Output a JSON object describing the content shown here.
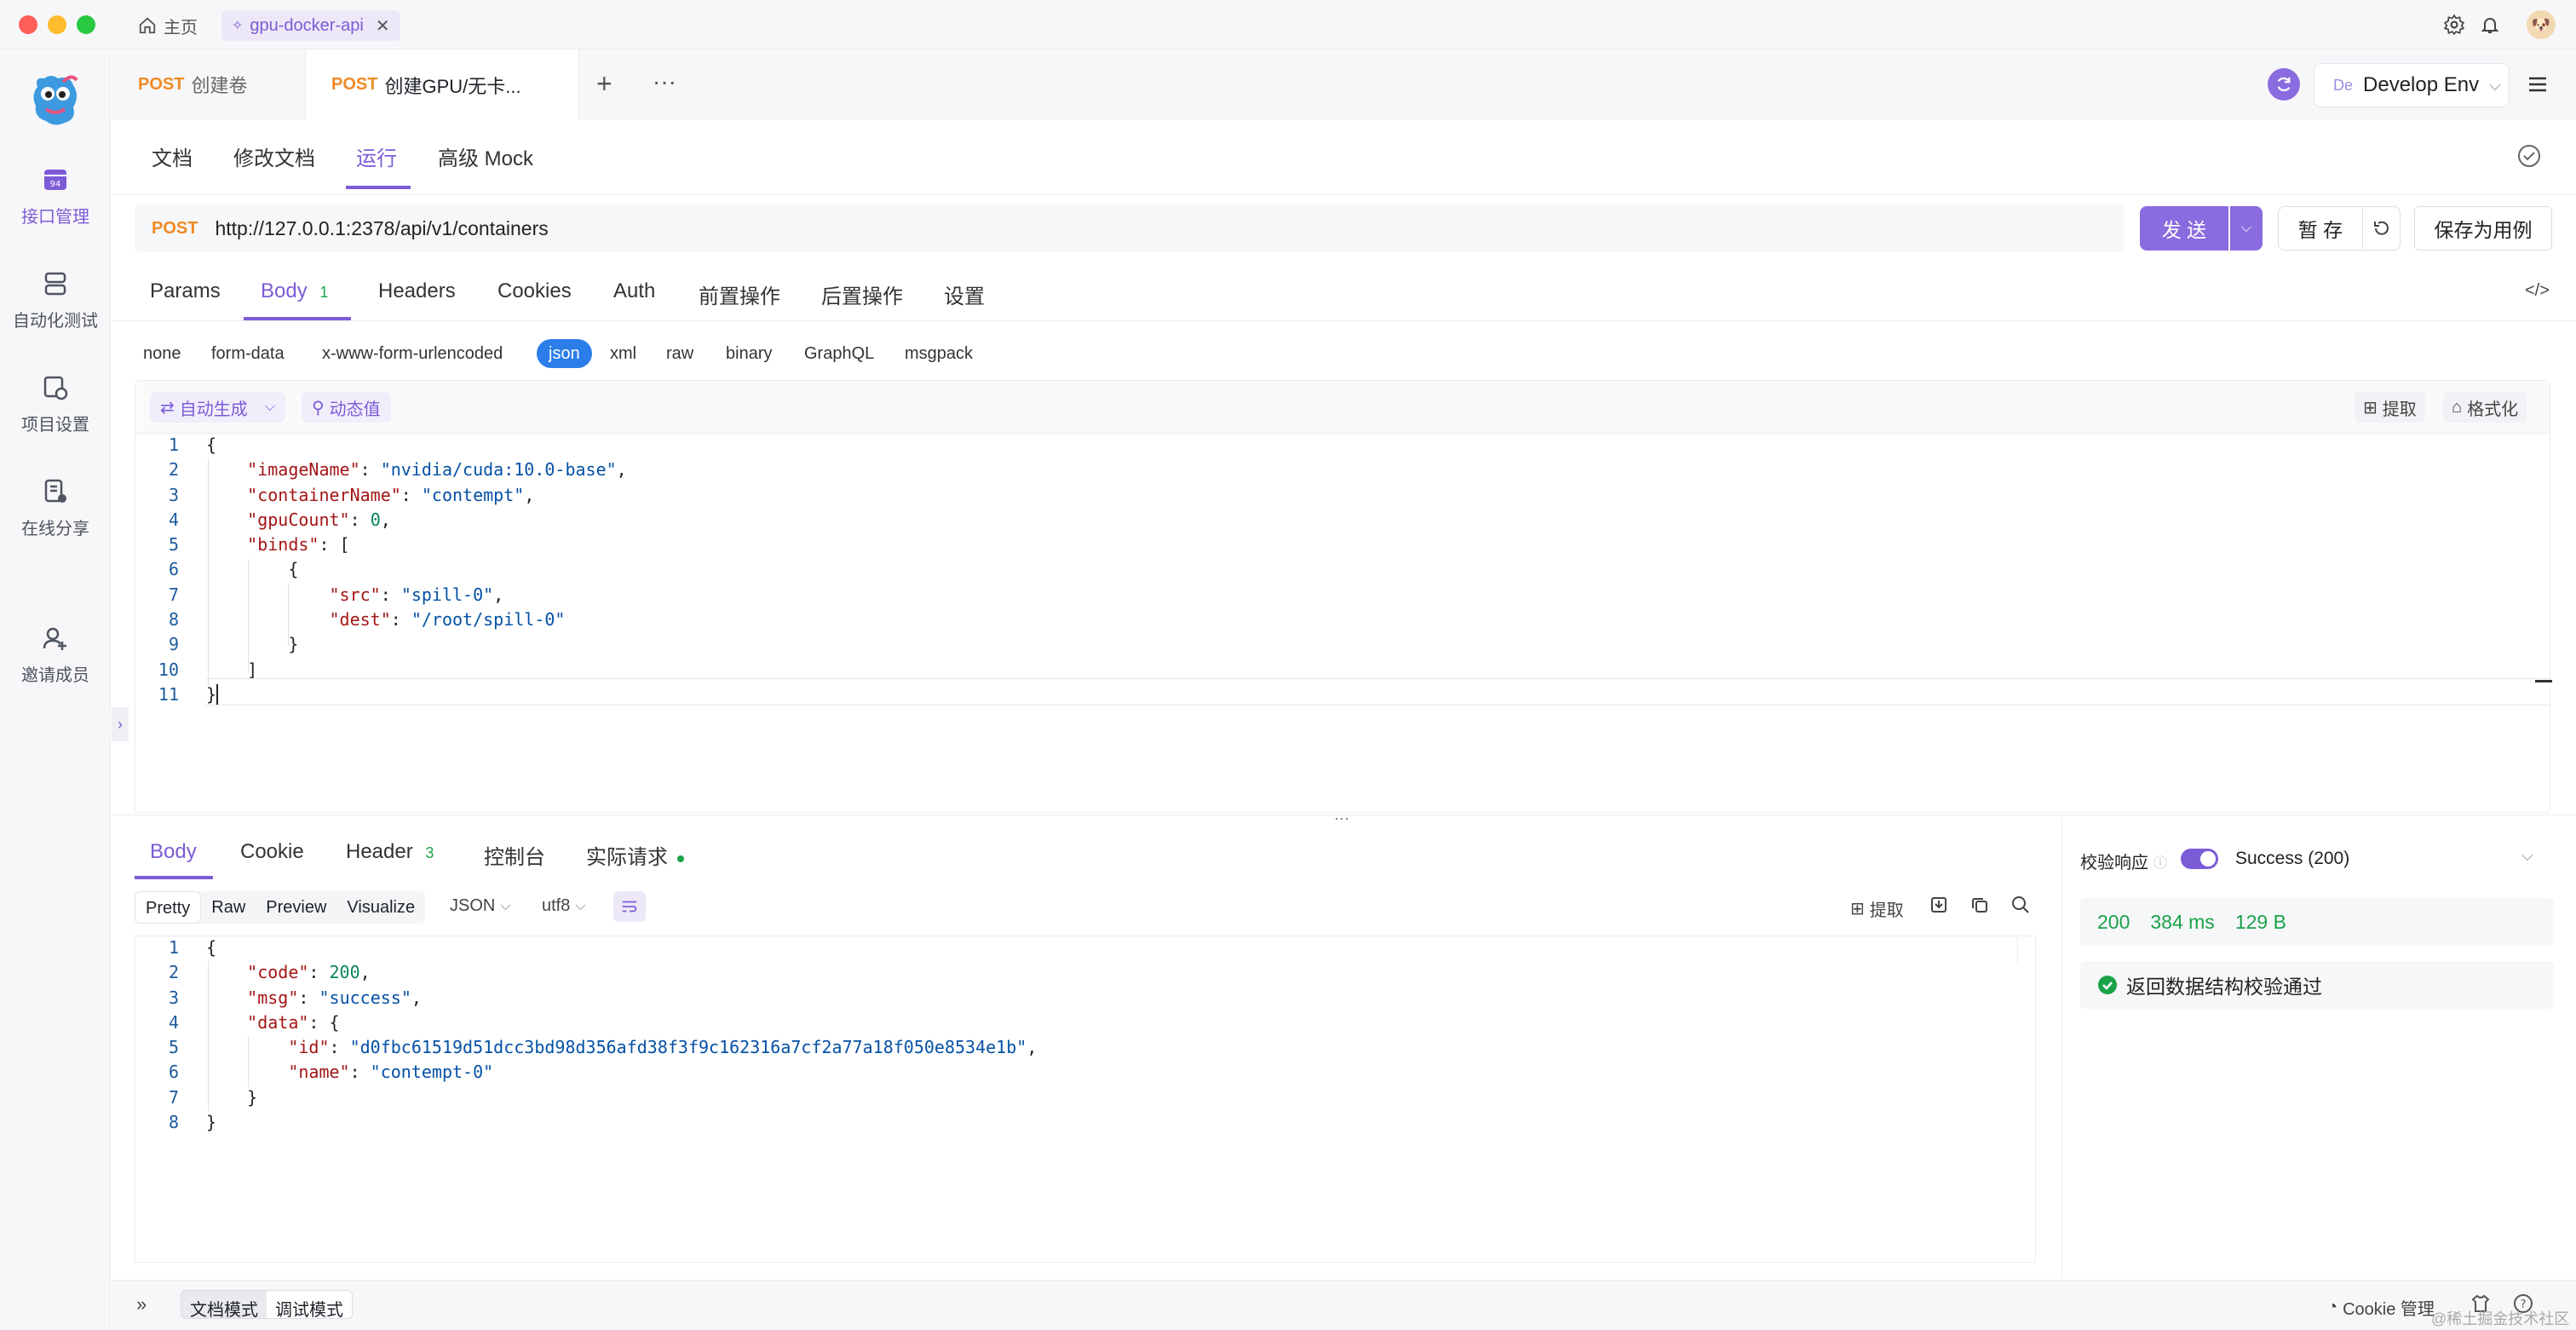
{
  "titlebar": {
    "home_tab": "主页",
    "project_tab": "gpu-docker-api"
  },
  "sidebar": {
    "items": [
      {
        "label": "接口管理"
      },
      {
        "label": "自动化测试"
      },
      {
        "label": "项目设置"
      },
      {
        "label": "在线分享"
      },
      {
        "label": "邀请成员"
      }
    ]
  },
  "request_tabs": [
    {
      "method": "POST",
      "label": "创建卷"
    },
    {
      "method": "POST",
      "label": "创建GPU/无卡..."
    }
  ],
  "env": {
    "badge": "De",
    "name": "Develop Env"
  },
  "nav_tabs": [
    "文档",
    "修改文档",
    "运行",
    "高级 Mock"
  ],
  "request": {
    "method": "POST",
    "url": "http://127.0.0.1:2378/api/v1/containers",
    "send_label": "发 送",
    "save_label": "暂 存",
    "save_case_label": "保存为用例"
  },
  "param_tabs": {
    "params": "Params",
    "body": "Body",
    "body_count": "1",
    "headers": "Headers",
    "cookies": "Cookies",
    "auth": "Auth",
    "pre": "前置操作",
    "post": "后置操作",
    "settings": "设置"
  },
  "body_formats": [
    "none",
    "form-data",
    "x-www-form-urlencoded",
    "json",
    "xml",
    "raw",
    "binary",
    "GraphQL",
    "msgpack"
  ],
  "editor_tools": {
    "auto_gen": "自动生成",
    "dynamic": "动态值",
    "extract": "提取",
    "format": "格式化"
  },
  "request_body": {
    "line_numbers": [
      "1",
      "2",
      "3",
      "4",
      "5",
      "6",
      "7",
      "8",
      "9",
      "10",
      "11"
    ],
    "l2_key": "\"imageName\"",
    "l2_val": "\"nvidia/cuda:10.0-base\"",
    "l3_key": "\"containerName\"",
    "l3_val": "\"contempt\"",
    "l4_key": "\"gpuCount\"",
    "l4_val": "0",
    "l5_key": "\"binds\"",
    "l7_key": "\"src\"",
    "l7_val": "\"spill-0\"",
    "l8_key": "\"dest\"",
    "l8_val": "\"/root/spill-0\""
  },
  "response_tabs": {
    "body": "Body",
    "cookie": "Cookie",
    "header": "Header",
    "header_count": "3",
    "console": "控制台",
    "actual": "实际请求"
  },
  "response_views": [
    "Pretty",
    "Raw",
    "Preview",
    "Visualize"
  ],
  "response_format": "JSON",
  "response_encoding": "utf8",
  "response_tools": {
    "extract": "提取"
  },
  "response_body": {
    "line_numbers": [
      "1",
      "2",
      "3",
      "4",
      "5",
      "6",
      "7",
      "8"
    ],
    "l2_key": "\"code\"",
    "l2_val": "200",
    "l3_key": "\"msg\"",
    "l3_val": "\"success\"",
    "l4_key": "\"data\"",
    "l5_key": "\"id\"",
    "l5_val": "\"d0fbc61519d51dcc3bd98d356afd38f3f9c162316a7cf2a77a18f050e8534e1b\"",
    "l6_key": "\"name\"",
    "l6_val": "\"contempt-0\""
  },
  "validation": {
    "label": "校验响应",
    "status": "Success (200)",
    "code": "200",
    "time": "384 ms",
    "size": "129 B",
    "result": "返回数据结构校验通过"
  },
  "footer": {
    "doc_mode": "文档模式",
    "debug_mode": "调试模式",
    "cookie_mgr": "Cookie 管理",
    "watermark": "@稀土掘金技术社区"
  },
  "colors": {
    "accent": "#7c5cd6",
    "method_post": "#f08a24",
    "success": "#1aa24a"
  }
}
